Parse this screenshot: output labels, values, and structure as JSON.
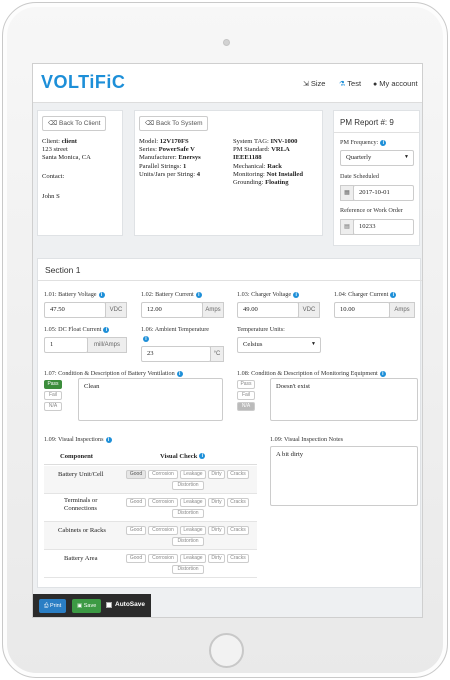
{
  "app": {
    "logo": "VOLTiFiC"
  },
  "nav": {
    "size": "Size",
    "test": "Test",
    "account": "My account"
  },
  "client": {
    "back_btn": "Back To Client",
    "name_label": "Client:",
    "name": "client",
    "street": "123 street",
    "city": "Santa Monica, CA",
    "contact_label": "Contact:",
    "contact": "John S"
  },
  "system": {
    "back_btn": "Back To System",
    "left": [
      {
        "k": "Model:",
        "v": "12V170FS"
      },
      {
        "k": "Series:",
        "v": "PowerSafe V"
      },
      {
        "k": "Manufacturer:",
        "v": "Enersys"
      },
      {
        "k": "Parallel Strings:",
        "v": "1"
      },
      {
        "k": "Units/Jars per String:",
        "v": "4"
      }
    ],
    "right": [
      {
        "k": "System TAG:",
        "v": "INV-1000"
      },
      {
        "k": "PM Standard:",
        "v": "VRLA"
      },
      {
        "k": "",
        "v": "IEEE1188"
      },
      {
        "k": "Mechanical:",
        "v": "Rack"
      },
      {
        "k": "Monitoring:",
        "v": "Not Installed"
      },
      {
        "k": "Grounding:",
        "v": "Floating"
      }
    ]
  },
  "pm": {
    "title": "PM Report #:",
    "number": "9",
    "freq_label": "PM Frequency:",
    "freq_value": "Quarterly",
    "date_label": "Date Scheduled",
    "date_value": "2017-10-01",
    "ref_label": "Reference or Work Order",
    "ref_value": "10233"
  },
  "section": {
    "title": "Section 1"
  },
  "fields": {
    "f101": {
      "label": "1.01: Battery Voltage",
      "value": "47.50",
      "unit": "VDC"
    },
    "f102": {
      "label": "1.02: Battery Current",
      "value": "12.00",
      "unit": "Amps"
    },
    "f103": {
      "label": "1.03: Charger Voltage",
      "value": "49.00",
      "unit": "VDC"
    },
    "f104": {
      "label": "1.04: Charger Current",
      "value": "10.00",
      "unit": "Amps"
    },
    "f105": {
      "label": "1.05: DC Float Current",
      "value": "1",
      "unit": "mill/Amps"
    },
    "f106": {
      "label": "1.06: Ambient Temperature",
      "value": "23",
      "unit": "°C"
    },
    "temp": {
      "label": "Temperature Units:",
      "value": "Celsius"
    }
  },
  "f107": {
    "label": "1.07: Condition & Description of Battery Ventilation",
    "text": "Clean",
    "opts": [
      "Pass",
      "Fail",
      "N/A"
    ]
  },
  "f108": {
    "label": "1.08: Condition & Description of Monitoring Equipment",
    "text": "Doesn't exist",
    "opts": [
      "Pass",
      "Fail",
      "N/A"
    ]
  },
  "f109": {
    "label": "1.09: Visual Inspections",
    "col_component": "Component",
    "col_visual": "Visual Check",
    "rows": [
      {
        "name": "Battery Unit/Cell",
        "checks": [
          "Good",
          "Corrosion",
          "Leakage",
          "Dirty",
          "Cracks",
          "Distortion"
        ]
      },
      {
        "name": "Terminals or Connections",
        "checks": [
          "Good",
          "Corrosion",
          "Leakage",
          "Dirty",
          "Cracks",
          "Distortion"
        ]
      },
      {
        "name": "Cabinets or Racks",
        "checks": [
          "Good",
          "Corrosion",
          "Leakage",
          "Dirty",
          "Cracks",
          "Distortion"
        ]
      },
      {
        "name": "Battery Area",
        "checks": [
          "Good",
          "Corrosion",
          "Leakage",
          "Dirty",
          "Cracks",
          "Distortion"
        ]
      }
    ]
  },
  "notes": {
    "label": "1.09: Visual Inspection Notes",
    "text": "A bit dirty"
  },
  "footer": {
    "print": "Print",
    "save": "Save",
    "autosave": "AutoSave"
  },
  "colors": {
    "brand": "#1d8fd8",
    "pass": "#3c8d3c",
    "save": "#3c9a44",
    "print": "#2a7ec4",
    "footer_bg": "#2b2b2b"
  }
}
